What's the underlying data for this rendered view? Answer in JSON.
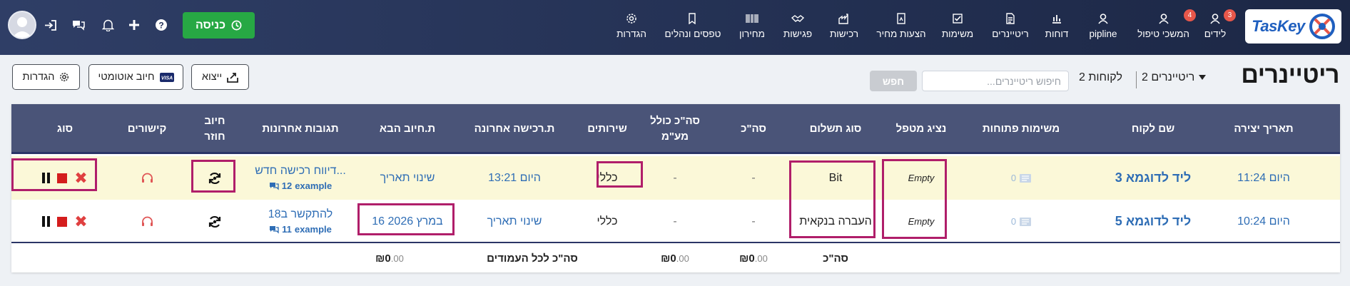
{
  "brand": {
    "name": "TasKey"
  },
  "nav": [
    {
      "key": "leads",
      "label": "לידים",
      "icon": "user-icon",
      "badge": "3"
    },
    {
      "key": "followup",
      "label": "המשכי טיפול",
      "icon": "user-icon",
      "badge": "4"
    },
    {
      "key": "pipeline",
      "label": "pipline",
      "icon": "user-icon",
      "badge": ""
    },
    {
      "key": "reports",
      "label": "דוחות",
      "icon": "bar-chart-icon",
      "badge": ""
    },
    {
      "key": "retainers",
      "label": "ריטיינרים",
      "icon": "document-list-icon",
      "badge": ""
    },
    {
      "key": "tasks",
      "label": "משימות",
      "icon": "checkbox-icon",
      "badge": ""
    },
    {
      "key": "quotes",
      "label": "הצעות מחיר",
      "icon": "quote-doc-icon",
      "badge": ""
    },
    {
      "key": "purchases",
      "label": "רכישות",
      "icon": "factory-icon",
      "badge": ""
    },
    {
      "key": "meetings",
      "label": "פגישות",
      "icon": "handshake-icon",
      "badge": ""
    },
    {
      "key": "pricelist",
      "label": "מחירון",
      "icon": "barcode-icon",
      "badge": ""
    },
    {
      "key": "forms",
      "label": "טפסים ונהלים",
      "icon": "forms-icon",
      "badge": ""
    },
    {
      "key": "settings",
      "label": "הגדרות",
      "icon": "gear-icon",
      "badge": ""
    }
  ],
  "topbar": {
    "enter_label": "כניסה",
    "icons": [
      "help-icon",
      "plus-icon",
      "bell-icon",
      "chat-icon",
      "login-icon"
    ]
  },
  "page": {
    "title": "ריטיינרים",
    "retainers_count_label": "2 ריטיינרים",
    "clients_count_label": "2 לקוחות",
    "search_placeholder": "חיפוש ריטיינרים...",
    "search_button": "חפש",
    "buttons": {
      "export": "ייצוא",
      "auto_charge": "חיוב אוטומטי",
      "settings": "הגדרות"
    }
  },
  "table": {
    "columns": {
      "created": "תאריך יצירה",
      "client": "שם לקוח",
      "open_tasks": "משימות פתוחות",
      "agent": "נציג מטפל",
      "payment_type": "סוג תשלום",
      "total": "סה\"כ",
      "total_vat_l1": "סה\"כ כולל",
      "total_vat_l2": "מע\"מ",
      "services": "שירותים",
      "last_purchase": "ת.רכישה אחרונה",
      "next_charge": "ת.חיוב הבא",
      "recent_comments": "תגובות אחרונות",
      "recurring_l1": "חיוב",
      "recurring_l2": "חוזר",
      "links": "קישורים",
      "type": "סוג"
    },
    "rows": [
      {
        "created": "היום 11:24",
        "client": "ליד לדוגמא 3",
        "open_tasks": "0",
        "agent": "Empty",
        "payment_type": "Bit",
        "total": "-",
        "total_vat": "-",
        "services": "כללי",
        "last_purchase": "היום 13:21",
        "next_charge": "שינוי תאריך",
        "comment_title": "דיווח רכישה חדש...",
        "comment_user": "example",
        "comment_count": "12"
      },
      {
        "created": "היום 10:24",
        "client": "ליד לדוגמא 5",
        "open_tasks": "0",
        "agent": "Empty",
        "payment_type": "העברה בנקאית",
        "total": "-",
        "total_vat": "-",
        "services": "כללי",
        "last_purchase": "שינוי תאריך",
        "next_charge": "16 במרץ 2026",
        "comment_title": "להתקשר ב18",
        "comment_user": "example",
        "comment_count": "11"
      }
    ],
    "footer": {
      "label_total": "סה\"כ",
      "label_all_columns": "סה\"כ לכל העמודים",
      "total_amount": "0",
      "total_vat_amount": "0",
      "all_columns_amount": "0",
      "decimals": ".00",
      "currency": "₪"
    }
  }
}
